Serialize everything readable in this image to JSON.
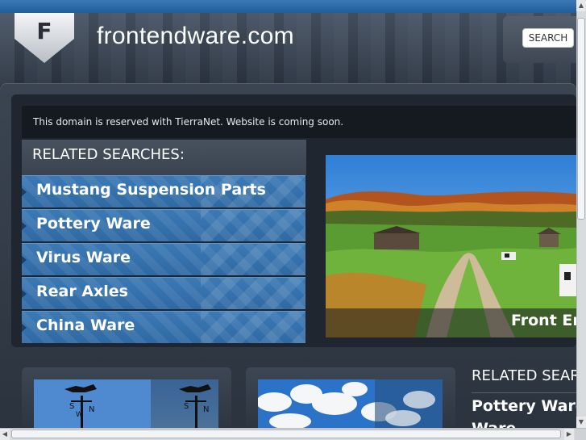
{
  "header": {
    "logo_letter": "F",
    "site_title": "frontendware.com",
    "search_label": "SEARCH"
  },
  "notice": {
    "text": "This domain is reserved with TierraNet. Website is coming soon."
  },
  "related": {
    "title": "RELATED SEARCHES:",
    "items": [
      {
        "label": "Mustang Suspension Parts"
      },
      {
        "label": "Pottery Ware"
      },
      {
        "label": "Virus Ware"
      },
      {
        "label": "Rear Axles"
      },
      {
        "label": "China Ware"
      }
    ]
  },
  "feature": {
    "caption": "Front En"
  },
  "related_side": {
    "title": "RELATED SEAR",
    "items": [
      {
        "label": "Pottery Ware"
      },
      {
        "label": "Ware"
      }
    ]
  },
  "colors": {
    "link_blue": "#3b79b5",
    "dark_bg": "#2a3340",
    "top_strip": "#1f5d9a"
  }
}
